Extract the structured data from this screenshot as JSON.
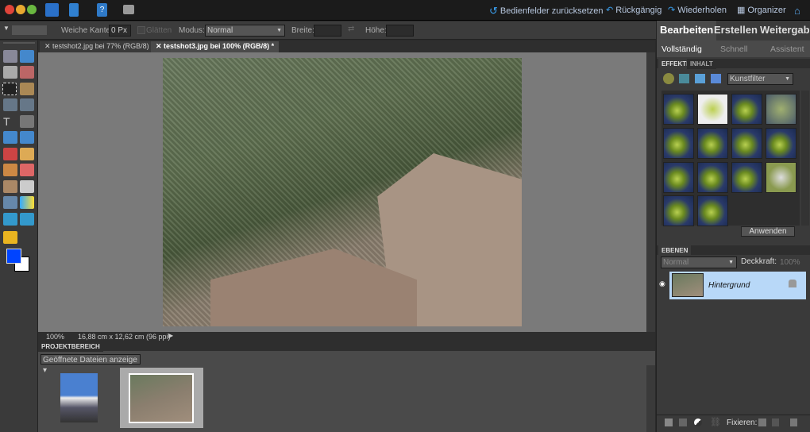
{
  "topbar": {
    "reset_panels": "Bedienfelder zurücksetzen",
    "undo": "Rückgängig",
    "redo": "Wiederholen",
    "organizer": "Organizer"
  },
  "options": {
    "feather_label": "Weiche Kante:",
    "feather_value": "0 Px",
    "antialias_label": "Glätten",
    "mode_label": "Modus:",
    "mode_value": "Normal",
    "width_label": "Breite:",
    "height_label": "Höhe:"
  },
  "tabs": [
    {
      "label": "testshot2.jpg bei 77% (RGB/8) *"
    },
    {
      "label": "testshot3.jpg bei 100% (RGB/8) *"
    }
  ],
  "status": {
    "zoom": "100%",
    "size": "16,88 cm x 12,62 cm (96 ppi)"
  },
  "project": {
    "title": "PROJEKTBEREICH",
    "dropdown": "Geöffnete Dateien anzeige"
  },
  "right": {
    "tabs": [
      "Bearbeiten",
      "Erstellen",
      "Weitergabe"
    ],
    "modes": [
      "Vollständig",
      "Schnell",
      "Assistent"
    ],
    "effects_tab": "EFFEKTE",
    "content_tab": "INHALT",
    "filter_category": "Kunstfilter",
    "apply": "Anwenden",
    "layers_title": "EBENEN",
    "blend_mode": "Normal",
    "opacity_label": "Deckkraft:",
    "opacity_value": "100%",
    "layer_name": "Hintergrund",
    "lock_label": "Fixieren:"
  },
  "colors": {
    "foreground": "#0044ff",
    "background": "#ffffff",
    "layer_selected": "#b8d8f8"
  }
}
